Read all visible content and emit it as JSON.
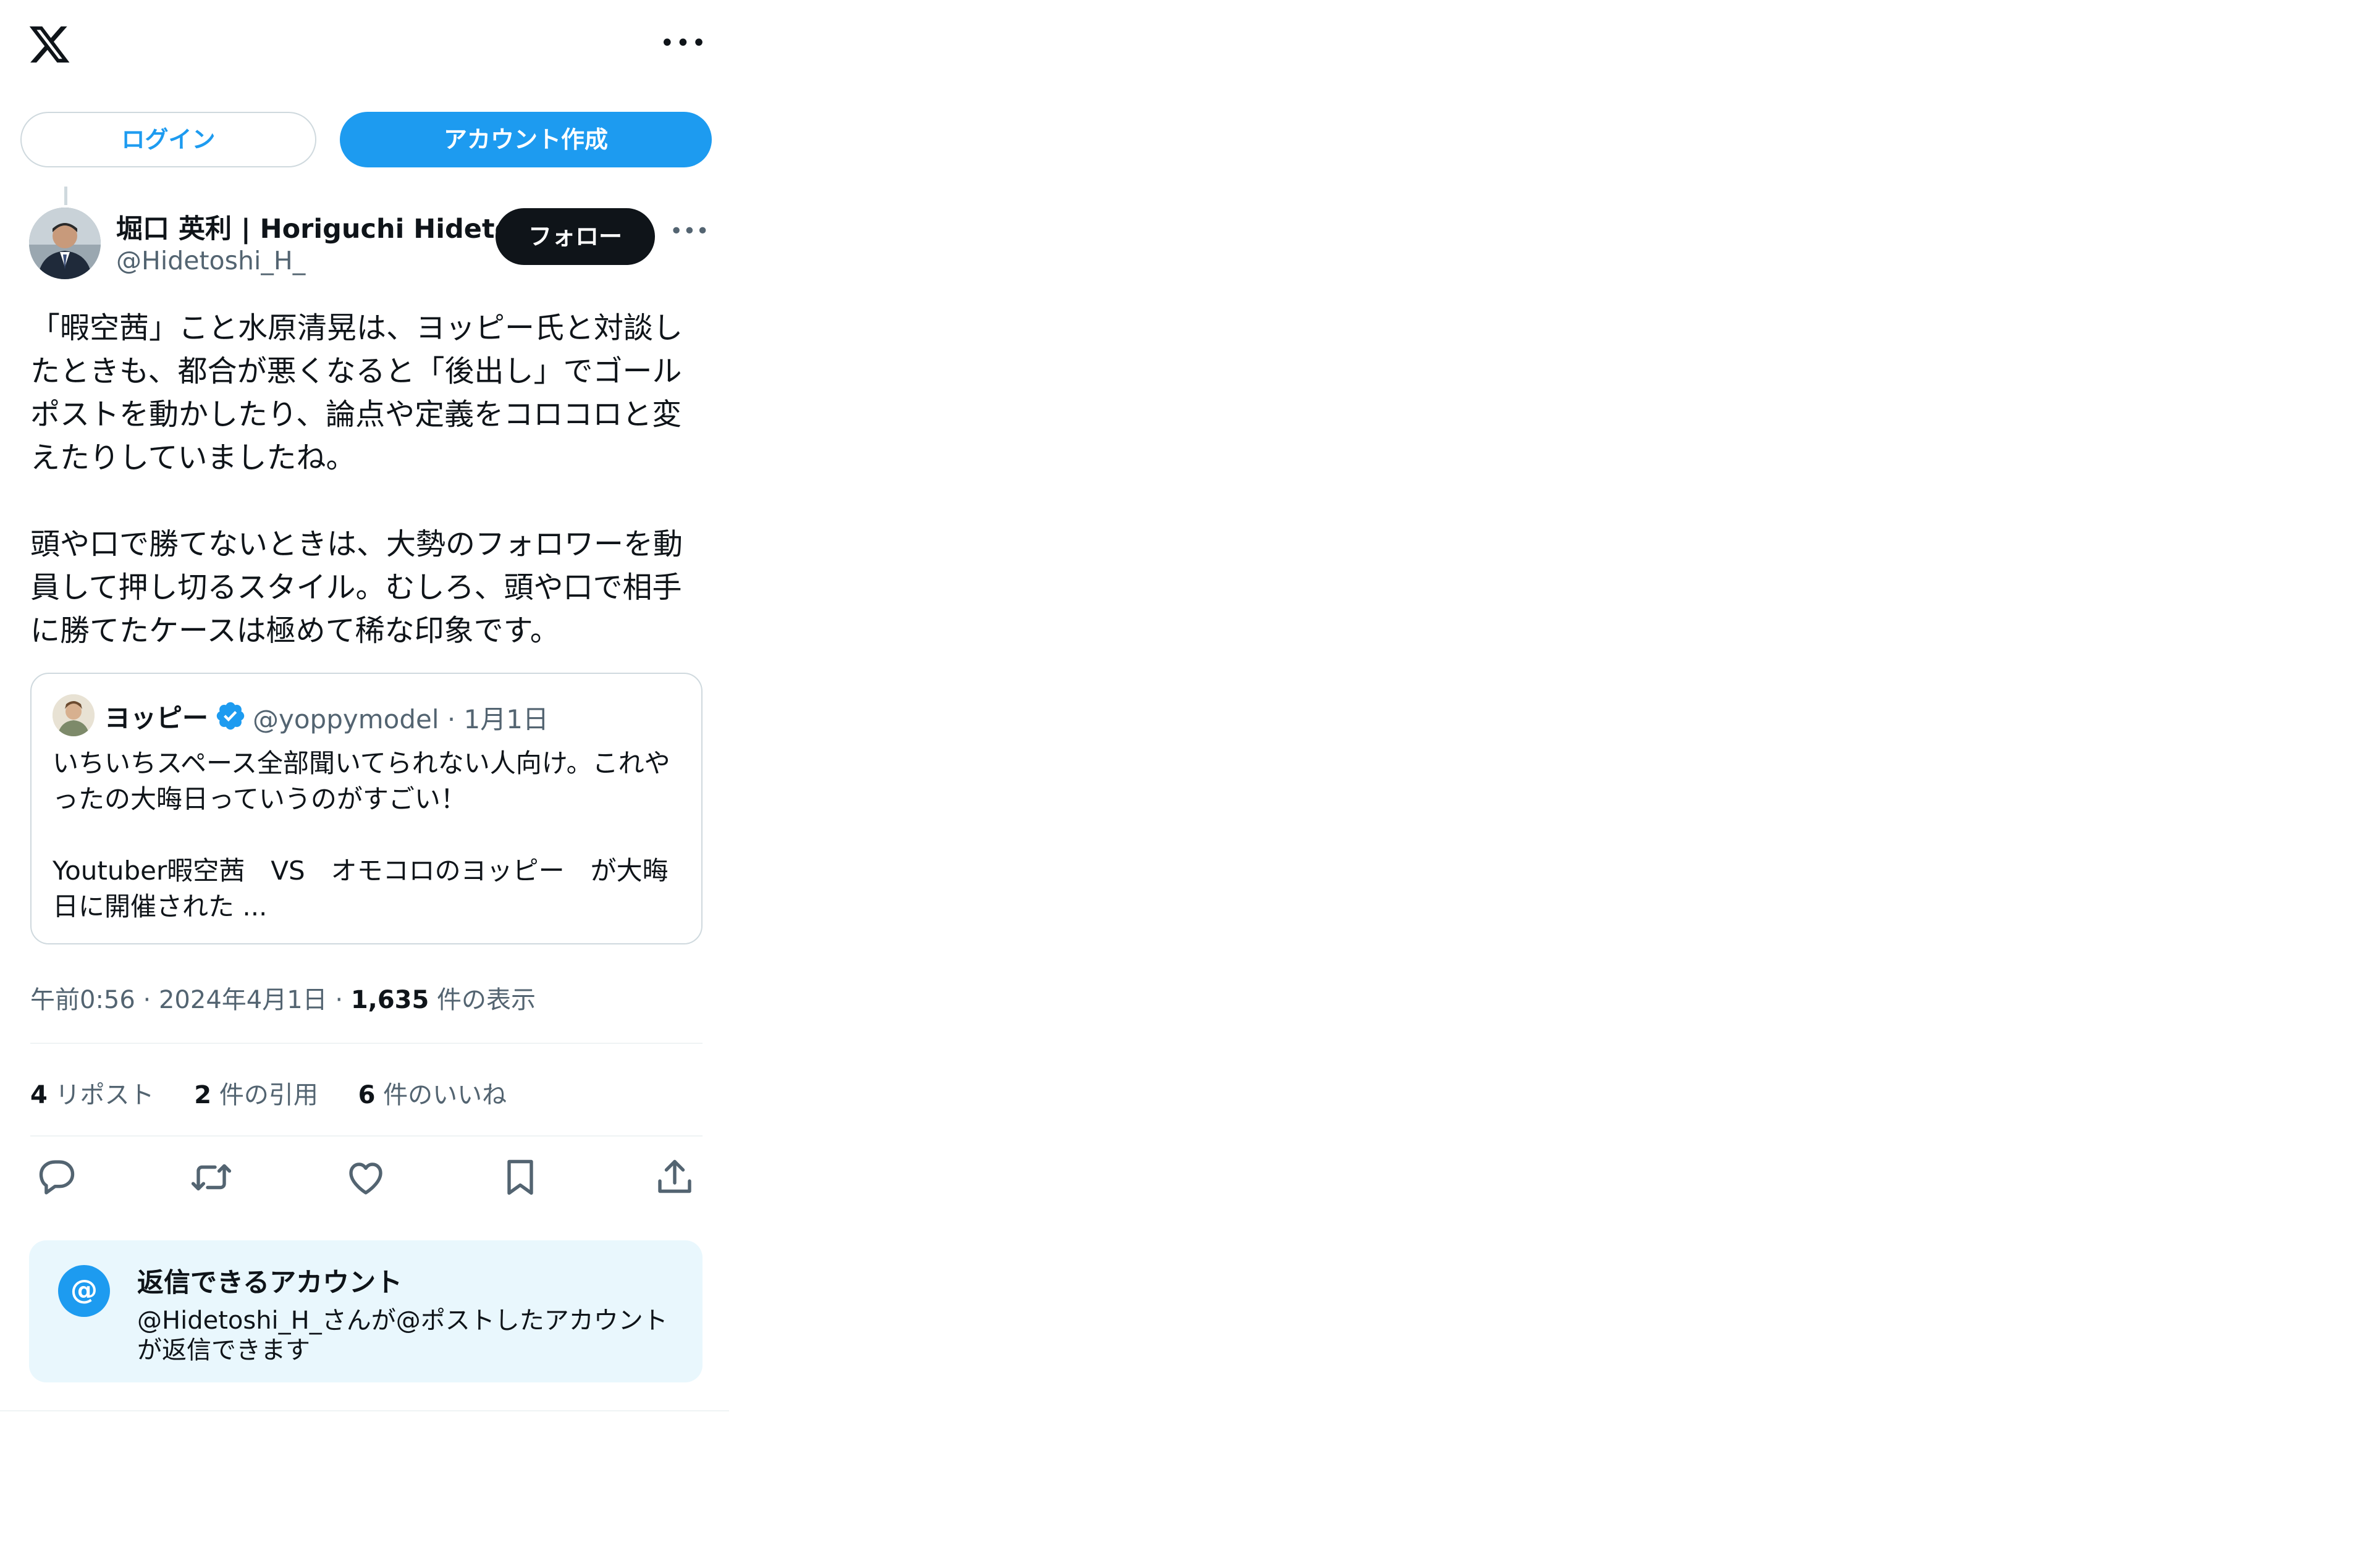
{
  "header": {
    "logo_icon": "x-logo-icon",
    "more_icon": "more-horizontal-icon",
    "more_glyph": "•••"
  },
  "auth": {
    "login_label": "ログイン",
    "signup_label": "アカウント作成"
  },
  "tweet": {
    "author_name": "堀口 英利 | Horiguchi Hidetos",
    "author_handle": "@Hidetoshi_H_",
    "follow_label": "フォロー",
    "more_glyph": "•••",
    "text": "「暇空茜」こと水原清晃は、ヨッピー氏と対談し\nたときも、都合が悪くなると「後出し」でゴール\nポストを動かしたり、論点や定義をコロコロと変\nえたりしていましたね。\n\n頭や口で勝てないときは、大勢のフォロワーを動\n員して押し切るスタイル。むしろ、頭や口で相手\nに勝てたケースは極めて稀な印象です。",
    "quote": {
      "name": "ヨッピー",
      "verified_icon": "verified-badge-icon",
      "handle_date": "@yoppymodel · 1月1日",
      "text": "いちいちスペース全部聞いてられない人向け。これや\nったの大晦日っていうのがすごい！\n\nYoutuber暇空茜　VS　オモコロのヨッピー　が大晦\n日に開催された ..."
    },
    "time": "午前0:56 · 2024年4月1日 · ",
    "views_count": "1,635",
    "views_label": " 件の表示",
    "stats": {
      "reposts_count": "4",
      "reposts_label": " リポスト",
      "quotes_count": "2",
      "quotes_label": " 件の引用",
      "likes_count": "6",
      "likes_label": " 件のいいね"
    },
    "actions": [
      "reply-icon",
      "retweet-icon",
      "like-icon",
      "bookmark-icon",
      "share-icon"
    ]
  },
  "reply_info": {
    "at_glyph": "@",
    "title": "返信できるアカウント",
    "desc": "@Hidetoshi_H_さんが@ポストしたアカウント\nが返信できます"
  },
  "colors": {
    "accent": "#1d9bf0",
    "text": "#0f1419",
    "secondary": "#536471",
    "border": "#cfd9de",
    "info_bg": "#e9f7fd"
  }
}
